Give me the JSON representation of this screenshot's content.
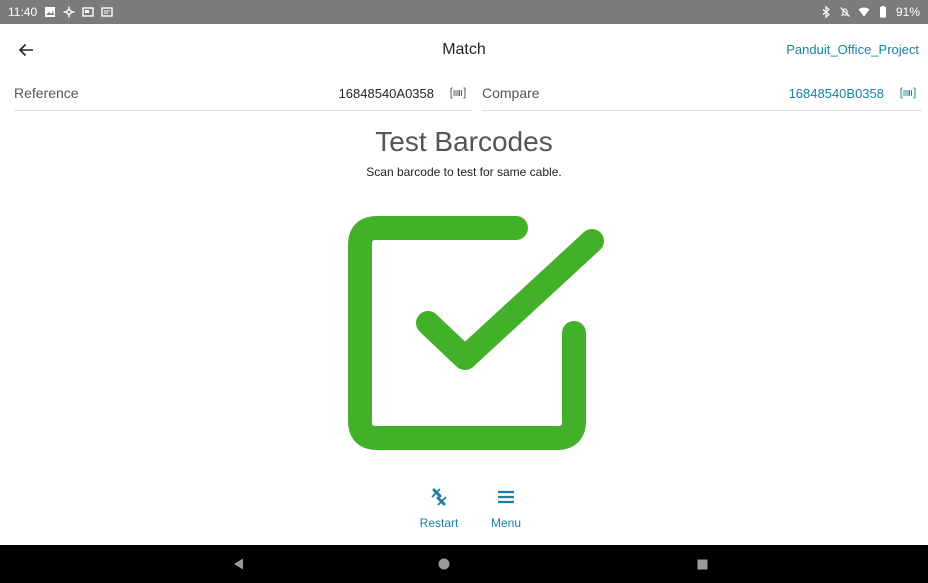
{
  "status_bar": {
    "time": "11:40",
    "battery": "91%",
    "icons_left": [
      "image-icon",
      "network-icon",
      "cast-icon",
      "screenshot-icon"
    ],
    "icons_right": [
      "bluetooth-icon",
      "mute-icon",
      "wifi-icon",
      "battery-icon"
    ]
  },
  "app_bar": {
    "title": "Match",
    "project": "Panduit_Office_Project"
  },
  "fields": {
    "reference_label": "Reference",
    "reference_value": "16848540A0358",
    "compare_label": "Compare",
    "compare_value": "16848540B0358"
  },
  "main": {
    "heading": "Test Barcodes",
    "subheading": "Scan barcode to test for same cable.",
    "result_color": "#43b02a"
  },
  "actions": {
    "restart_label": "Restart",
    "menu_label": "Menu"
  },
  "colors": {
    "accent": "#1a7fa6",
    "status_bar": "#7b7b7b",
    "success": "#43b02a"
  }
}
